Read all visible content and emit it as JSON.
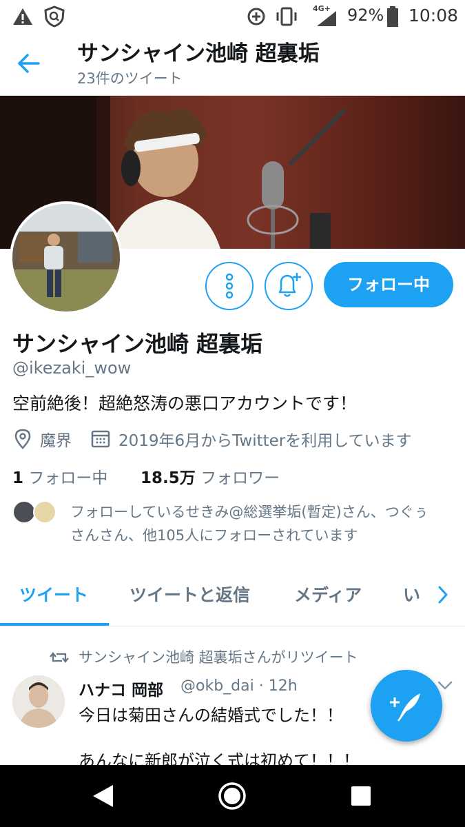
{
  "status_bar": {
    "network": "4G+",
    "battery": "92%",
    "time": "10:08",
    "icons": [
      "warning-icon",
      "shield-icon",
      "data-saver-icon",
      "vibrate-icon",
      "signal-icon",
      "battery-icon"
    ]
  },
  "header": {
    "title": "サンシャイン池崎 超裏垢",
    "tweet_count": "23件のツイート"
  },
  "profile": {
    "name": "サンシャイン池崎 超裏垢",
    "handle": "@ikezaki_wow",
    "bio": "空前絶後！超絶怒涛の悪口アカウントです！",
    "location": "魔界",
    "joined": "2019年6月からTwitterを利用しています",
    "following_count": "1",
    "following_label": "フォロー中",
    "followers_count": "18.5万",
    "followers_label": "フォロワー",
    "followed_by_line1": "フォローしているせきみ@総選挙垢(暫定)さん、つぐぅ",
    "followed_by_line2": "さんさん、他105人にフォローされています",
    "follow_button": "フォロー中"
  },
  "tabs": [
    {
      "label": "ツイート",
      "active": true
    },
    {
      "label": "ツイートと返信",
      "active": false
    },
    {
      "label": "メディア",
      "active": false
    },
    {
      "label": "い",
      "active": false
    }
  ],
  "tweet": {
    "retweet_note": "サンシャイン池崎 超裏垢さんがリツイート",
    "author": "ハナコ 岡部",
    "handle_time": "@okb_dai · 12h",
    "line1": "今日は菊田さんの結婚式でした！！",
    "line2": "あんなに新郎が泣く式は初めて！！！"
  },
  "colors": {
    "accent": "#1da1f2",
    "text": "#14171a",
    "muted": "#657786"
  }
}
